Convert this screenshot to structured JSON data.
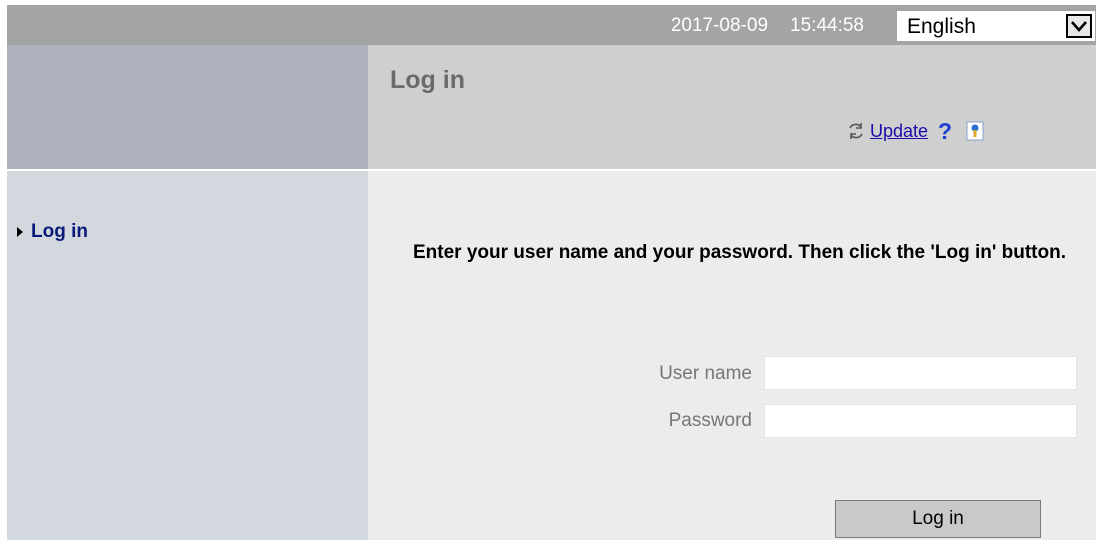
{
  "topbar": {
    "date": "2017-08-09",
    "time": "15:44:58",
    "language": {
      "selected": "English"
    }
  },
  "header": {
    "title": "Log in",
    "update_label": "Update",
    "help_glyph": "?",
    "icons": [
      "refresh-icon",
      "help-icon",
      "security-icon"
    ]
  },
  "sidebar": {
    "items": [
      {
        "label": "Log in",
        "icon": "triangle-right-icon"
      }
    ]
  },
  "login": {
    "instructions": "Enter your user name and your password. Then click the 'Log in' button.",
    "username_label": "User name",
    "username_value": "",
    "password_label": "Password",
    "password_value": "",
    "button_label": "Log in"
  },
  "colors": {
    "topbar": "#a3a4a4",
    "header_left": "#aeb2bd",
    "header_right": "#cfcfcf",
    "sidebar": "#d3d7de",
    "content": "#ececec",
    "link": "#1a0dab",
    "nav_text": "#0a1a7a"
  }
}
